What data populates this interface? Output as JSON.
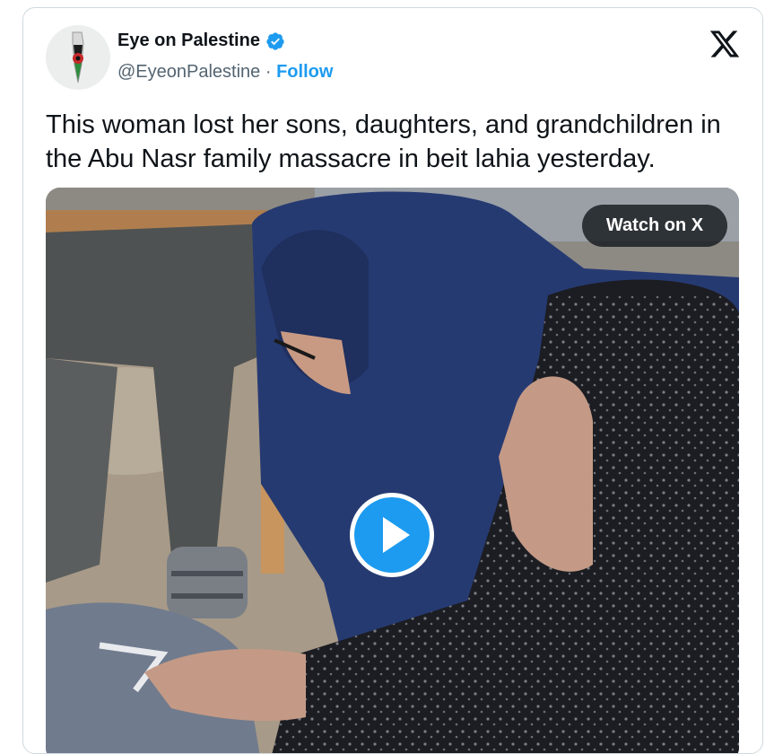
{
  "tweet": {
    "author": {
      "name": "Eye on Palestine",
      "handle": "@EyeonPalestine",
      "separator": "·",
      "follow_label": "Follow",
      "verified": true
    },
    "text": "This woman lost her sons, daughters, and grandchildren in the Abu Nasr family massacre in beit lahia yesterday.",
    "media": {
      "type": "video",
      "watch_label": "Watch on X"
    }
  },
  "icons": {
    "verified": "verified-badge-icon",
    "platform": "x-logo-icon",
    "play": "play-icon"
  },
  "colors": {
    "accent": "#1d9bf0",
    "text_primary": "#0f1419",
    "text_secondary": "#536471",
    "border": "#cfd9de"
  }
}
